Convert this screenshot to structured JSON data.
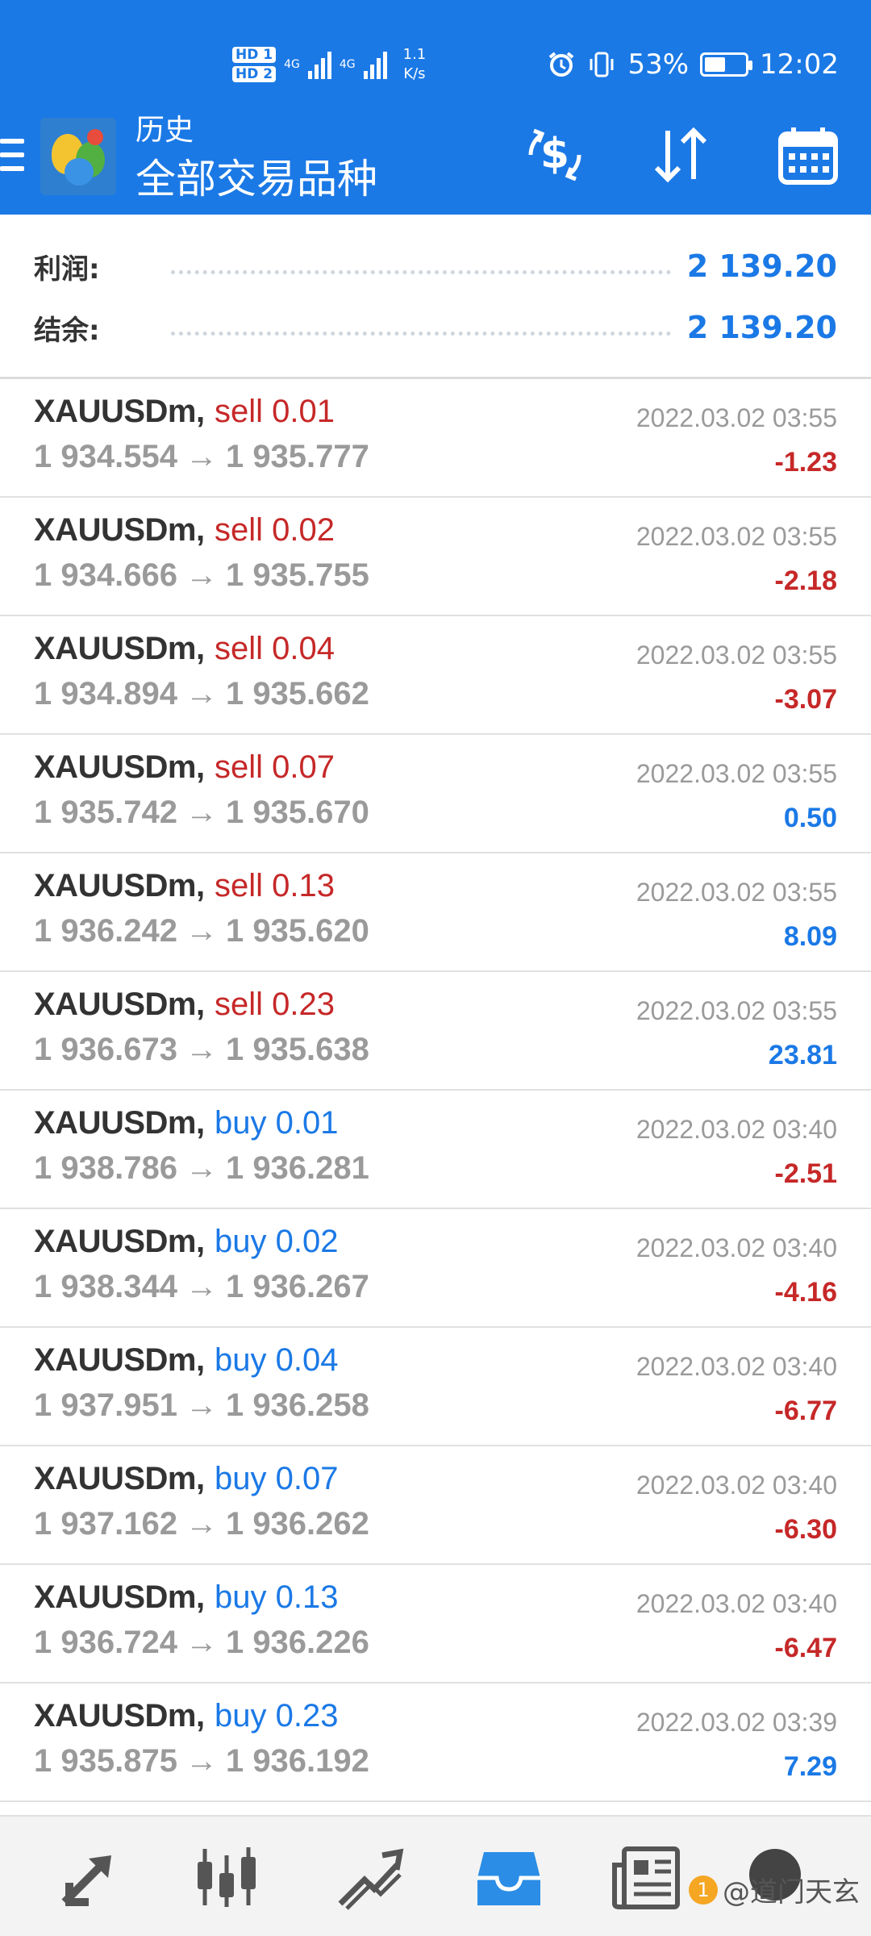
{
  "status_bar": {
    "sim1": "HD 1",
    "sim2": "HD 2",
    "net_type1": "4G",
    "net_type2": "4G",
    "net_speed_value": "1.1",
    "net_speed_unit": "K/s",
    "battery": "53%",
    "battery_level": 0.53,
    "time": "12:02",
    "icons": [
      "alarm-icon",
      "vibrate-icon",
      "battery-icon"
    ]
  },
  "header": {
    "subtitle": "历史",
    "title": "全部交易品种",
    "icons": [
      "menu-icon",
      "app-logo",
      "currency-filter-icon",
      "sort-icon",
      "calendar-icon"
    ]
  },
  "summary": {
    "profit_label": "利润:",
    "profit_value": "2 139.20",
    "balance_label": "结余:",
    "balance_value": "2 139.20"
  },
  "trades": [
    {
      "symbol": "XAUUSDm,",
      "side": "sell 0.01",
      "type": "sell",
      "open": "1 934.554",
      "arrow": "→",
      "close": "1 935.777",
      "time": "2022.03.02 03:55",
      "profit": "-1.23"
    },
    {
      "symbol": "XAUUSDm,",
      "side": "sell 0.02",
      "type": "sell",
      "open": "1 934.666",
      "arrow": "→",
      "close": "1 935.755",
      "time": "2022.03.02 03:55",
      "profit": "-2.18"
    },
    {
      "symbol": "XAUUSDm,",
      "side": "sell 0.04",
      "type": "sell",
      "open": "1 934.894",
      "arrow": "→",
      "close": "1 935.662",
      "time": "2022.03.02 03:55",
      "profit": "-3.07"
    },
    {
      "symbol": "XAUUSDm,",
      "side": "sell 0.07",
      "type": "sell",
      "open": "1 935.742",
      "arrow": "→",
      "close": "1 935.670",
      "time": "2022.03.02 03:55",
      "profit": "0.50"
    },
    {
      "symbol": "XAUUSDm,",
      "side": "sell 0.13",
      "type": "sell",
      "open": "1 936.242",
      "arrow": "→",
      "close": "1 935.620",
      "time": "2022.03.02 03:55",
      "profit": "8.09"
    },
    {
      "symbol": "XAUUSDm,",
      "side": "sell 0.23",
      "type": "sell",
      "open": "1 936.673",
      "arrow": "→",
      "close": "1 935.638",
      "time": "2022.03.02 03:55",
      "profit": "23.81"
    },
    {
      "symbol": "XAUUSDm,",
      "side": "buy 0.01",
      "type": "buy",
      "open": "1 938.786",
      "arrow": "→",
      "close": "1 936.281",
      "time": "2022.03.02 03:40",
      "profit": "-2.51"
    },
    {
      "symbol": "XAUUSDm,",
      "side": "buy 0.02",
      "type": "buy",
      "open": "1 938.344",
      "arrow": "→",
      "close": "1 936.267",
      "time": "2022.03.02 03:40",
      "profit": "-4.16"
    },
    {
      "symbol": "XAUUSDm,",
      "side": "buy 0.04",
      "type": "buy",
      "open": "1 937.951",
      "arrow": "→",
      "close": "1 936.258",
      "time": "2022.03.02 03:40",
      "profit": "-6.77"
    },
    {
      "symbol": "XAUUSDm,",
      "side": "buy 0.07",
      "type": "buy",
      "open": "1 937.162",
      "arrow": "→",
      "close": "1 936.262",
      "time": "2022.03.02 03:40",
      "profit": "-6.30"
    },
    {
      "symbol": "XAUUSDm,",
      "side": "buy 0.13",
      "type": "buy",
      "open": "1 936.724",
      "arrow": "→",
      "close": "1 936.226",
      "time": "2022.03.02 03:40",
      "profit": "-6.47"
    },
    {
      "symbol": "XAUUSDm,",
      "side": "buy 0.23",
      "type": "buy",
      "open": "1 935.875",
      "arrow": "→",
      "close": "1 936.192",
      "time": "2022.03.02 03:39",
      "profit": "7.29"
    }
  ],
  "bottom_nav": {
    "items": [
      "quotes-icon",
      "chart-icon",
      "trade-icon",
      "history-icon",
      "news-icon",
      "chat-icon"
    ],
    "active": "history-icon"
  },
  "watermark": {
    "badge": "1",
    "text": "@道门天玄"
  },
  "colors": {
    "accent": "#1b79e6",
    "negative": "#c62828",
    "muted": "#9a9a9a"
  }
}
